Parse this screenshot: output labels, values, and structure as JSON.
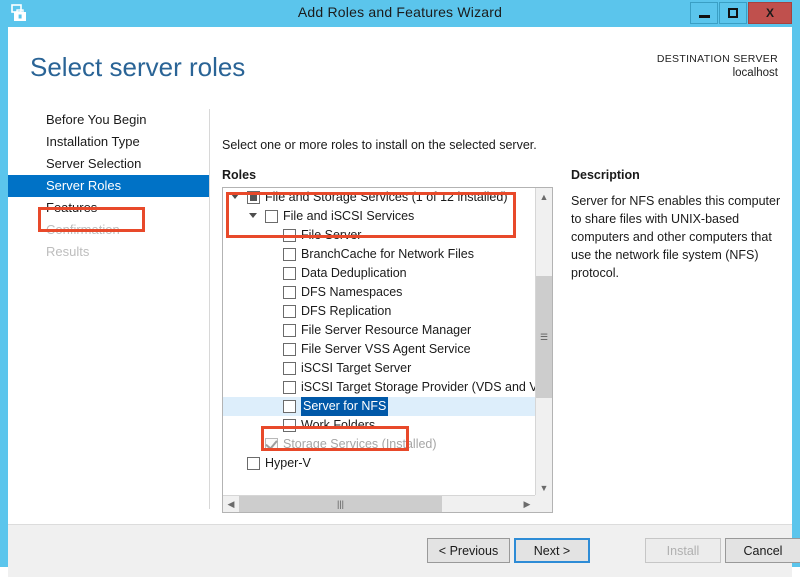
{
  "window": {
    "title": "Add Roles and Features Wizard",
    "app_icon": "server-wizard-icon",
    "minimize_label": "Minimize",
    "maximize_label": "Maximize",
    "close_label": "X",
    "accent_color": "#5bc5ec",
    "close_color": "#c0504d"
  },
  "header": {
    "page_title": "Select server roles",
    "destination_label": "DESTINATION SERVER",
    "destination_value": "localhost",
    "title_color": "#2a6496"
  },
  "sidebar": {
    "items": [
      {
        "label": "Before You Begin",
        "state": "normal"
      },
      {
        "label": "Installation Type",
        "state": "normal"
      },
      {
        "label": "Server Selection",
        "state": "normal"
      },
      {
        "label": "Server Roles",
        "state": "selected"
      },
      {
        "label": "Features",
        "state": "normal"
      },
      {
        "label": "Confirmation",
        "state": "disabled"
      },
      {
        "label": "Results",
        "state": "disabled"
      }
    ],
    "selected_color": "#0072c6",
    "annotation_color": "#e8492a"
  },
  "main": {
    "instruction": "Select one or more roles to install on the selected server.",
    "roles_label": "Roles",
    "description_label": "Description",
    "description_body": "Server for NFS enables this computer to share files with UNIX-based computers and other computers that use the network file system (NFS) protocol."
  },
  "roles_tree": [
    {
      "label": "File and Storage Services (1 of 12 installed)",
      "level": 0,
      "checkbox": "partial",
      "expander": "expanded",
      "selected": false,
      "grayed": false
    },
    {
      "label": "File and iSCSI Services",
      "level": 1,
      "checkbox": "unchecked",
      "expander": "expanded",
      "selected": false,
      "grayed": false
    },
    {
      "label": "File Server",
      "level": 2,
      "checkbox": "unchecked",
      "expander": "none",
      "selected": false,
      "grayed": false
    },
    {
      "label": "BranchCache for Network Files",
      "level": 2,
      "checkbox": "unchecked",
      "expander": "none",
      "selected": false,
      "grayed": false
    },
    {
      "label": "Data Deduplication",
      "level": 2,
      "checkbox": "unchecked",
      "expander": "none",
      "selected": false,
      "grayed": false
    },
    {
      "label": "DFS Namespaces",
      "level": 2,
      "checkbox": "unchecked",
      "expander": "none",
      "selected": false,
      "grayed": false
    },
    {
      "label": "DFS Replication",
      "level": 2,
      "checkbox": "unchecked",
      "expander": "none",
      "selected": false,
      "grayed": false
    },
    {
      "label": "File Server Resource Manager",
      "level": 2,
      "checkbox": "unchecked",
      "expander": "none",
      "selected": false,
      "grayed": false
    },
    {
      "label": "File Server VSS Agent Service",
      "level": 2,
      "checkbox": "unchecked",
      "expander": "none",
      "selected": false,
      "grayed": false
    },
    {
      "label": "iSCSI Target Server",
      "level": 2,
      "checkbox": "unchecked",
      "expander": "none",
      "selected": false,
      "grayed": false
    },
    {
      "label": "iSCSI Target Storage Provider (VDS and VSS",
      "level": 2,
      "checkbox": "unchecked",
      "expander": "none",
      "selected": false,
      "grayed": false
    },
    {
      "label": "Server for NFS",
      "level": 2,
      "checkbox": "unchecked",
      "expander": "none",
      "selected": true,
      "grayed": false
    },
    {
      "label": "Work Folders",
      "level": 2,
      "checkbox": "unchecked",
      "expander": "none",
      "selected": false,
      "grayed": false
    },
    {
      "label": "Storage Services (Installed)",
      "level": 1,
      "checkbox": "checked-gray",
      "expander": "none",
      "selected": false,
      "grayed": true
    },
    {
      "label": "Hyper-V",
      "level": 0,
      "checkbox": "unchecked",
      "expander": "none",
      "selected": false,
      "grayed": false
    }
  ],
  "scrollbars": {
    "v_up_icon": "chevron-up-icon",
    "v_down_icon": "chevron-down-icon",
    "v_grip_icon": "grip-icon",
    "h_left_icon": "chevron-left-icon",
    "h_right_icon": "chevron-right-icon",
    "h_grip_icon": "grip-icon"
  },
  "footer": {
    "previous_label": "< Previous",
    "next_label": "Next >",
    "install_label": "Install",
    "cancel_label": "Cancel",
    "install_enabled": false,
    "focus_color": "#2e8cd6"
  }
}
